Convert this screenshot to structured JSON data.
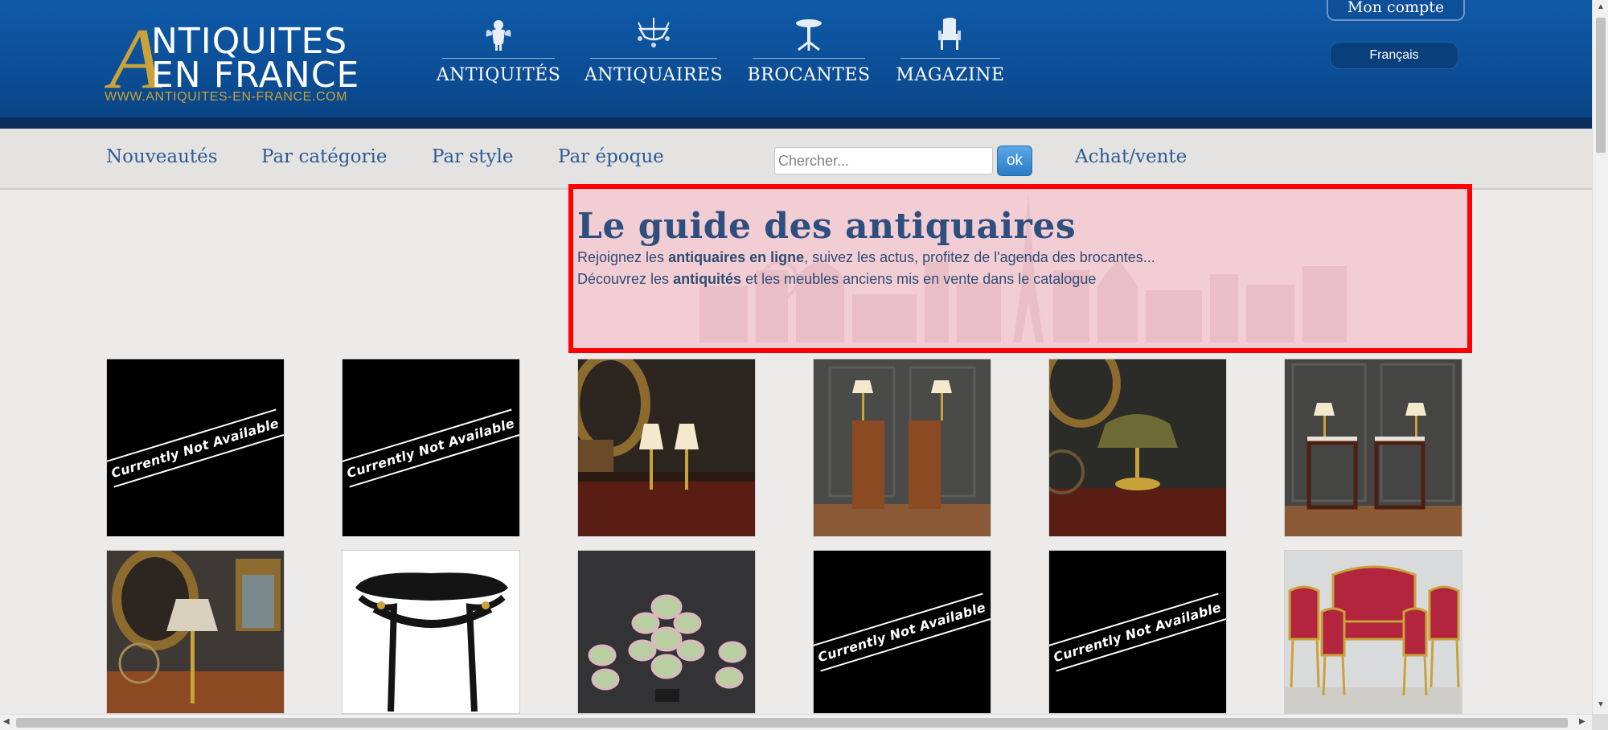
{
  "logo": {
    "big_letter": "A",
    "line1": "NTIQUITES",
    "line2": "EN FRANCE",
    "url": "WWW.ANTIQUITES-EN-FRANCE.COM"
  },
  "main_nav": [
    {
      "label": "ANTIQUITÉS",
      "icon": "cherub-icon"
    },
    {
      "label": "ANTIQUAIRES",
      "icon": "chandelier-icon"
    },
    {
      "label": "BROCANTES",
      "icon": "gueridon-table-icon"
    },
    {
      "label": "MAGAZINE",
      "icon": "armchair-icon"
    }
  ],
  "account": {
    "label": "Mon compte",
    "language": "Français"
  },
  "sub_nav": {
    "links": [
      "Nouveautés",
      "Par catégorie",
      "Par style",
      "Par époque"
    ],
    "search_placeholder": "Chercher...",
    "search_button": "ok",
    "achat": "Achat/vente"
  },
  "hero": {
    "title": "Le guide des antiquaires",
    "line1": {
      "before": "Rejoignez les ",
      "bold": "antiquaires en ligne",
      "after": ", suivez les actus, profitez de l'agenda des brocantes..."
    },
    "line2": {
      "before": "Découvrez les ",
      "bold": "antiquités",
      "after": " et les meubles anciens mis en vente dans le catalogue"
    }
  },
  "grid": {
    "not_available_text": "Currently Not Available",
    "rows": [
      [
        {
          "kind": "not-available"
        },
        {
          "kind": "not-available"
        },
        {
          "kind": "photo",
          "subject": "pair of table lamps with gilt mirror"
        },
        {
          "kind": "photo",
          "subject": "pair of mahogany nightstands"
        },
        {
          "kind": "photo",
          "subject": "bouillotte lamp"
        },
        {
          "kind": "photo",
          "subject": "pair of marble-top side tables"
        }
      ],
      [
        {
          "kind": "photo",
          "subject": "oval mirror, portrait and lamp"
        },
        {
          "kind": "photo",
          "subject": "black Napoleon III table"
        },
        {
          "kind": "photo",
          "subject": "barbotine plates"
        },
        {
          "kind": "not-available"
        },
        {
          "kind": "not-available"
        },
        {
          "kind": "photo",
          "subject": "red upholstered salon set"
        }
      ]
    ]
  },
  "colors": {
    "header_blue": "#0b4c93",
    "gold": "#c9a23a",
    "link_blue": "#2e5c95",
    "highlight_red": "#ff0000"
  }
}
